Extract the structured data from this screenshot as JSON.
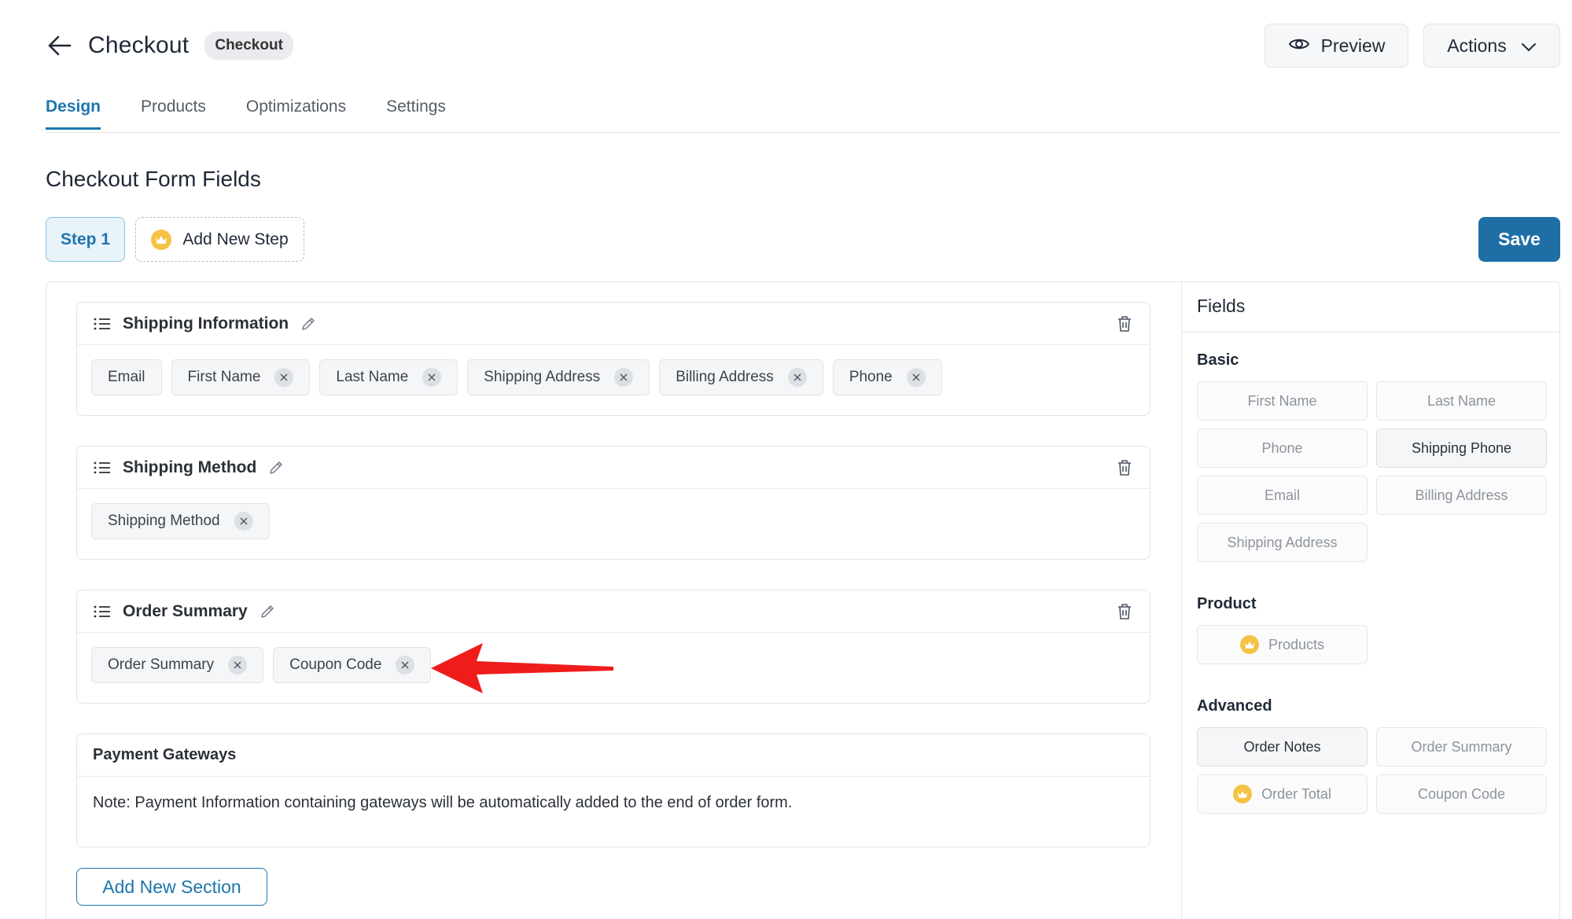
{
  "header": {
    "title": "Checkout",
    "badge": "Checkout",
    "preview_label": "Preview",
    "actions_label": "Actions"
  },
  "tabs": [
    {
      "label": "Design",
      "active": true
    },
    {
      "label": "Products",
      "active": false
    },
    {
      "label": "Optimizations",
      "active": false
    },
    {
      "label": "Settings",
      "active": false
    }
  ],
  "main": {
    "heading": "Checkout Form Fields",
    "step_label": "Step 1",
    "add_step_label": "Add New Step",
    "save_label": "Save",
    "add_section_label": "Add New Section"
  },
  "sections": [
    {
      "title": "Shipping Information",
      "fields": [
        {
          "label": "Email",
          "removable": false
        },
        {
          "label": "First Name",
          "removable": true
        },
        {
          "label": "Last Name",
          "removable": true
        },
        {
          "label": "Shipping Address",
          "removable": true
        },
        {
          "label": "Billing Address",
          "removable": true
        },
        {
          "label": "Phone",
          "removable": true
        }
      ]
    },
    {
      "title": "Shipping Method",
      "fields": [
        {
          "label": "Shipping Method",
          "removable": true
        }
      ]
    },
    {
      "title": "Order Summary",
      "fields": [
        {
          "label": "Order Summary",
          "removable": true
        },
        {
          "label": "Coupon Code",
          "removable": true
        }
      ]
    }
  ],
  "payment": {
    "title": "Payment Gateways",
    "note": "Note: Payment Information containing gateways will be automatically added to the end of order form."
  },
  "sidebar": {
    "title": "Fields",
    "basic_label": "Basic",
    "basic": [
      {
        "label": "First Name",
        "enabled": false
      },
      {
        "label": "Last Name",
        "enabled": false
      },
      {
        "label": "Phone",
        "enabled": false
      },
      {
        "label": "Shipping Phone",
        "enabled": true
      },
      {
        "label": "Email",
        "enabled": false
      },
      {
        "label": "Billing Address",
        "enabled": false
      },
      {
        "label": "Shipping Address",
        "enabled": false
      }
    ],
    "product_label": "Product",
    "product": [
      {
        "label": "Products",
        "enabled": false,
        "pro": true
      }
    ],
    "advanced_label": "Advanced",
    "advanced": [
      {
        "label": "Order Notes",
        "enabled": true
      },
      {
        "label": "Order Summary",
        "enabled": false
      },
      {
        "label": "Order Total",
        "enabled": false,
        "pro": true
      },
      {
        "label": "Coupon Code",
        "enabled": false
      }
    ]
  },
  "colors": {
    "accent": "#1f75ad",
    "save": "#1f6fa6",
    "arrow": "#ef1c1c",
    "crown": "#f6c244"
  }
}
